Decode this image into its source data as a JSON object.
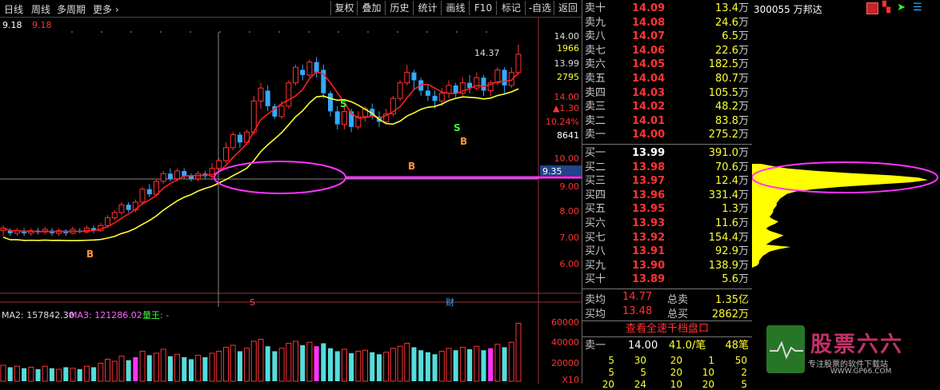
{
  "toolbar": {
    "period_day": "日线",
    "period_week": "周线",
    "multi_period": "多周期",
    "more": "更多",
    "buttons": [
      "复权",
      "叠加",
      "历史",
      "统计",
      "画线",
      "F10",
      "标记",
      "-自选",
      "返回"
    ]
  },
  "chart": {
    "price_left": "9.18",
    "price_right": "9.18",
    "cross_price": "9.35",
    "high_label": "14.37",
    "price_axis": [
      "14.00",
      "1966",
      "13.99",
      "2795",
      "14.00",
      "▲1.30",
      "10.24%",
      "8641",
      "10.00",
      "9.00",
      "8.00",
      "7.00",
      "6.00"
    ],
    "marks": {
      "b": "B",
      "s": "S",
      "s_event": "S",
      "cai": "财"
    },
    "vol_info": {
      "ma2": "MA2: 157842.30",
      "ma3": "MA3: 121286.02",
      "liangwang": "量王: -"
    },
    "vol_axis": [
      "60000",
      "40000",
      "20000",
      "X10"
    ]
  },
  "chart_data": {
    "type": "candlestick",
    "ylim": [
      5.0,
      14.8
    ],
    "candles": [
      {
        "o": 7.2,
        "c": 7.3,
        "h": 7.4,
        "l": 7.0
      },
      {
        "o": 7.2,
        "c": 7.1,
        "h": 7.3,
        "l": 7.0
      },
      {
        "o": 7.1,
        "c": 7.2,
        "h": 7.3,
        "l": 7.0
      },
      {
        "o": 7.2,
        "c": 7.1,
        "h": 7.3,
        "l": 7.0
      },
      {
        "o": 7.1,
        "c": 7.2,
        "h": 7.3,
        "l": 7.0
      },
      {
        "o": 7.2,
        "c": 7.15,
        "h": 7.3,
        "l": 7.05
      },
      {
        "o": 7.15,
        "c": 7.25,
        "h": 7.35,
        "l": 7.05
      },
      {
        "o": 7.2,
        "c": 7.1,
        "h": 7.3,
        "l": 7.0
      },
      {
        "o": 7.1,
        "c": 7.2,
        "h": 7.3,
        "l": 7.0
      },
      {
        "o": 7.2,
        "c": 7.1,
        "h": 7.25,
        "l": 7.0
      },
      {
        "o": 7.1,
        "c": 7.25,
        "h": 7.35,
        "l": 7.05
      },
      {
        "o": 7.2,
        "c": 7.15,
        "h": 7.3,
        "l": 7.1
      },
      {
        "o": 7.15,
        "c": 7.3,
        "h": 7.4,
        "l": 7.1
      },
      {
        "o": 7.3,
        "c": 7.2,
        "h": 7.4,
        "l": 7.1
      },
      {
        "o": 7.2,
        "c": 7.4,
        "h": 7.5,
        "l": 7.15
      },
      {
        "o": 7.4,
        "c": 7.7,
        "h": 7.8,
        "l": 7.3
      },
      {
        "o": 7.7,
        "c": 7.9,
        "h": 8.0,
        "l": 7.6
      },
      {
        "o": 7.9,
        "c": 8.2,
        "h": 8.3,
        "l": 7.8
      },
      {
        "o": 8.2,
        "c": 8.0,
        "h": 8.3,
        "l": 7.9
      },
      {
        "o": 8.0,
        "c": 8.3,
        "h": 8.4,
        "l": 7.9
      },
      {
        "o": 8.3,
        "c": 8.8,
        "h": 8.9,
        "l": 8.2
      },
      {
        "o": 8.8,
        "c": 8.6,
        "h": 9.0,
        "l": 8.5
      },
      {
        "o": 8.6,
        "c": 9.1,
        "h": 9.2,
        "l": 8.5
      },
      {
        "o": 9.1,
        "c": 9.4,
        "h": 9.5,
        "l": 9.0
      },
      {
        "o": 9.4,
        "c": 9.2,
        "h": 9.6,
        "l": 9.1
      },
      {
        "o": 9.2,
        "c": 9.5,
        "h": 9.6,
        "l": 9.1
      },
      {
        "o": 9.5,
        "c": 9.3,
        "h": 9.6,
        "l": 9.2
      },
      {
        "o": 9.3,
        "c": 9.2,
        "h": 9.4,
        "l": 9.1
      },
      {
        "o": 9.2,
        "c": 9.4,
        "h": 9.5,
        "l": 9.1
      },
      {
        "o": 9.4,
        "c": 9.3,
        "h": 9.5,
        "l": 9.2
      },
      {
        "o": 9.3,
        "c": 9.6,
        "h": 9.8,
        "l": 9.2
      },
      {
        "o": 9.6,
        "c": 9.9,
        "h": 10.0,
        "l": 9.5
      },
      {
        "o": 9.9,
        "c": 10.4,
        "h": 10.6,
        "l": 9.8
      },
      {
        "o": 10.4,
        "c": 10.9,
        "h": 11.0,
        "l": 10.3
      },
      {
        "o": 10.9,
        "c": 10.6,
        "h": 11.0,
        "l": 10.4
      },
      {
        "o": 10.6,
        "c": 11.0,
        "h": 11.1,
        "l": 10.5
      },
      {
        "o": 11.0,
        "c": 12.2,
        "h": 12.4,
        "l": 10.9
      },
      {
        "o": 12.2,
        "c": 12.7,
        "h": 12.9,
        "l": 11.9
      },
      {
        "o": 12.6,
        "c": 12.0,
        "h": 12.8,
        "l": 11.8
      },
      {
        "o": 12.0,
        "c": 11.6,
        "h": 12.1,
        "l": 11.5
      },
      {
        "o": 11.6,
        "c": 12.0,
        "h": 12.2,
        "l": 11.5
      },
      {
        "o": 12.0,
        "c": 12.9,
        "h": 13.0,
        "l": 11.9
      },
      {
        "o": 12.9,
        "c": 13.5,
        "h": 13.6,
        "l": 12.8
      },
      {
        "o": 13.4,
        "c": 13.2,
        "h": 13.6,
        "l": 13.0
      },
      {
        "o": 13.2,
        "c": 13.7,
        "h": 13.8,
        "l": 13.1
      },
      {
        "o": 13.7,
        "c": 13.3,
        "h": 13.9,
        "l": 13.1
      },
      {
        "o": 13.4,
        "c": 12.5,
        "h": 13.6,
        "l": 12.3
      },
      {
        "o": 12.5,
        "c": 11.8,
        "h": 12.6,
        "l": 11.6
      },
      {
        "o": 11.8,
        "c": 11.3,
        "h": 12.0,
        "l": 11.1
      },
      {
        "o": 11.3,
        "c": 11.8,
        "h": 12.0,
        "l": 11.1
      },
      {
        "o": 11.8,
        "c": 11.2,
        "h": 11.9,
        "l": 11.0
      },
      {
        "o": 11.2,
        "c": 11.6,
        "h": 11.8,
        "l": 11.1
      },
      {
        "o": 11.6,
        "c": 11.9,
        "h": 12.0,
        "l": 11.4
      },
      {
        "o": 11.9,
        "c": 11.6,
        "h": 12.1,
        "l": 11.5
      },
      {
        "o": 11.6,
        "c": 11.4,
        "h": 11.8,
        "l": 11.2
      },
      {
        "o": 11.4,
        "c": 11.7,
        "h": 11.9,
        "l": 11.3
      },
      {
        "o": 11.7,
        "c": 12.3,
        "h": 12.4,
        "l": 11.6
      },
      {
        "o": 12.3,
        "c": 12.9,
        "h": 13.0,
        "l": 12.2
      },
      {
        "o": 12.9,
        "c": 13.3,
        "h": 13.6,
        "l": 12.8
      },
      {
        "o": 13.3,
        "c": 13.0,
        "h": 13.4,
        "l": 12.6
      },
      {
        "o": 13.0,
        "c": 12.6,
        "h": 13.1,
        "l": 12.4
      },
      {
        "o": 12.6,
        "c": 12.4,
        "h": 12.8,
        "l": 12.2
      },
      {
        "o": 12.4,
        "c": 12.2,
        "h": 12.6,
        "l": 11.9
      },
      {
        "o": 12.2,
        "c": 12.5,
        "h": 12.7,
        "l": 12.0
      },
      {
        "o": 12.5,
        "c": 12.8,
        "h": 13.0,
        "l": 12.3
      },
      {
        "o": 12.8,
        "c": 12.5,
        "h": 12.9,
        "l": 12.3
      },
      {
        "o": 12.5,
        "c": 12.9,
        "h": 13.1,
        "l": 12.4
      },
      {
        "o": 12.9,
        "c": 12.7,
        "h": 13.2,
        "l": 12.5
      },
      {
        "o": 12.7,
        "c": 13.1,
        "h": 13.3,
        "l": 12.6
      },
      {
        "o": 13.1,
        "c": 12.6,
        "h": 13.2,
        "l": 12.4
      },
      {
        "o": 12.6,
        "c": 12.9,
        "h": 13.0,
        "l": 12.4
      },
      {
        "o": 12.9,
        "c": 13.4,
        "h": 13.5,
        "l": 12.8
      },
      {
        "o": 13.4,
        "c": 12.8,
        "h": 13.5,
        "l": 12.5
      },
      {
        "o": 12.8,
        "c": 13.3,
        "h": 13.5,
        "l": 12.7
      },
      {
        "o": 13.3,
        "c": 14.0,
        "h": 14.37,
        "l": 13.2
      }
    ],
    "volume": [
      16,
      14,
      15,
      13,
      14,
      12,
      15,
      13,
      12,
      14,
      13,
      12,
      15,
      14,
      18,
      22,
      20,
      25,
      21,
      24,
      30,
      26,
      28,
      32,
      25,
      27,
      24,
      22,
      26,
      24,
      28,
      30,
      34,
      36,
      30,
      33,
      40,
      42,
      35,
      30,
      33,
      38,
      40,
      36,
      39,
      35,
      38,
      33,
      30,
      32,
      28,
      30,
      31,
      29,
      27,
      29,
      33,
      35,
      38,
      34,
      31,
      29,
      27,
      30,
      33,
      31,
      34,
      32,
      35,
      31,
      33,
      37,
      34,
      39,
      58
    ]
  },
  "orderbook": {
    "sell": [
      {
        "label": "卖十",
        "price": "14.09",
        "vol": "13.4",
        "unit": "万"
      },
      {
        "label": "卖九",
        "price": "14.08",
        "vol": "24.6",
        "unit": "万"
      },
      {
        "label": "卖八",
        "price": "14.07",
        "vol": "6.5",
        "unit": "万"
      },
      {
        "label": "卖七",
        "price": "14.06",
        "vol": "22.6",
        "unit": "万"
      },
      {
        "label": "卖六",
        "price": "14.05",
        "vol": "182.5",
        "unit": "万"
      },
      {
        "label": "卖五",
        "price": "14.04",
        "vol": "80.7",
        "unit": "万"
      },
      {
        "label": "卖四",
        "price": "14.03",
        "vol": "105.5",
        "unit": "万"
      },
      {
        "label": "卖三",
        "price": "14.02",
        "vol": "48.2",
        "unit": "万"
      },
      {
        "label": "卖二",
        "price": "14.01",
        "vol": "83.8",
        "unit": "万"
      },
      {
        "label": "卖一",
        "price": "14.00",
        "vol": "275.2",
        "unit": "万"
      }
    ],
    "buy": [
      {
        "label": "买一",
        "price": "13.99",
        "vol": "391.0",
        "unit": "万"
      },
      {
        "label": "买二",
        "price": "13.98",
        "vol": "70.6",
        "unit": "万"
      },
      {
        "label": "买三",
        "price": "13.97",
        "vol": "12.4",
        "unit": "万"
      },
      {
        "label": "买四",
        "price": "13.96",
        "vol": "331.4",
        "unit": "万"
      },
      {
        "label": "买五",
        "price": "13.95",
        "vol": "1.3",
        "unit": "万"
      },
      {
        "label": "买六",
        "price": "13.93",
        "vol": "11.6",
        "unit": "万"
      },
      {
        "label": "买七",
        "price": "13.92",
        "vol": "154.4",
        "unit": "万"
      },
      {
        "label": "买八",
        "price": "13.91",
        "vol": "92.9",
        "unit": "万"
      },
      {
        "label": "买九",
        "price": "13.90",
        "vol": "138.9",
        "unit": "万"
      },
      {
        "label": "买十",
        "price": "13.89",
        "vol": "5.6",
        "unit": "万"
      }
    ],
    "sell_avg_label": "卖均",
    "sell_avg": "14.77",
    "total_sell_label": "总卖",
    "total_sell": "1.35亿",
    "buy_avg_label": "买均",
    "buy_avg": "13.48",
    "total_buy_label": "总买",
    "total_buy": "2862万",
    "full_speed_btn": "查看全速千档盘口",
    "queue_label": "卖一",
    "queue_price": "14.00",
    "queue_vol": "41.0/笔",
    "queue_count": "48笔",
    "queue_rows": [
      [
        "5",
        "30",
        "20",
        "1",
        "50"
      ],
      [
        "5",
        "5",
        "20",
        "10",
        "2"
      ],
      [
        "20",
        "24",
        "10",
        "20",
        "5"
      ]
    ]
  },
  "stock": {
    "code_name": "300055 万邦达"
  },
  "depth_profile": [
    0.05,
    0.12,
    0.2,
    0.35,
    0.55,
    0.8,
    0.95,
    1.0,
    0.9,
    0.7,
    0.5,
    0.35,
    0.25,
    0.2,
    0.18,
    0.16,
    0.15,
    0.14,
    0.14,
    0.13,
    0.12,
    0.12,
    0.11,
    0.1,
    0.12,
    0.15,
    0.13,
    0.1,
    0.08,
    0.1,
    0.14,
    0.18,
    0.15,
    0.12,
    0.1,
    0.08,
    0.22,
    0.15,
    0.1,
    0.08,
    0.06,
    0.05,
    0.04,
    0.04,
    0.03
  ],
  "watermark": {
    "title": "股票六六",
    "sub": "专注股票的软件下载站",
    "url": "WWW.GP66.COM"
  },
  "colors": {
    "up": "#ff3333",
    "down": "#33aaff",
    "ma_red": "#ff2020",
    "ma_yellow": "#ffff33",
    "annot": "#ff33ff"
  }
}
